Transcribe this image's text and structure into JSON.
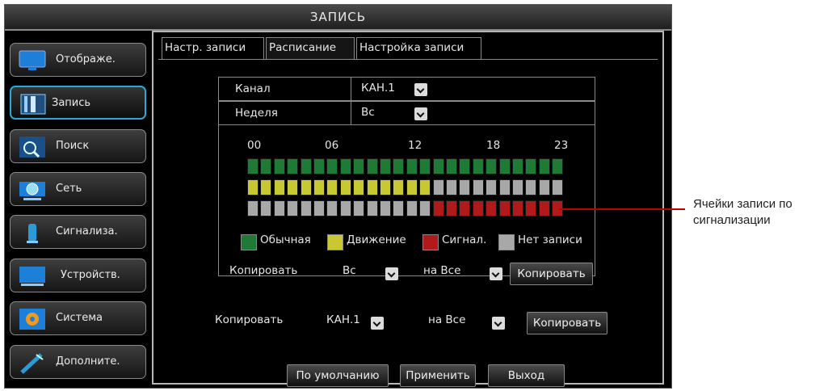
{
  "window": {
    "title": "ЗАПИСЬ"
  },
  "sidebar": {
    "items": [
      {
        "label": "Отображе.",
        "icon": "monitor-icon",
        "active": false
      },
      {
        "label": "Запись",
        "icon": "film-record-icon",
        "active": true
      },
      {
        "label": "Поиск",
        "icon": "search-magnifier-icon",
        "active": false
      },
      {
        "label": "Сеть",
        "icon": "network-globe-icon",
        "active": false
      },
      {
        "label": "Сигнализа.",
        "icon": "alarm-icon",
        "active": false
      },
      {
        "label": "Устройств.",
        "icon": "device-monitor-icon",
        "active": false
      },
      {
        "label": "Система",
        "icon": "gear-icon",
        "active": false
      },
      {
        "label": "Дополните.",
        "icon": "tools-icon",
        "active": false
      }
    ]
  },
  "tabs": [
    {
      "label": "Настр. записи",
      "selected": false
    },
    {
      "label": "Расписание",
      "selected": true
    },
    {
      "label": "Настройка записи",
      "selected": false
    }
  ],
  "schedule": {
    "channel_label": "Канал",
    "channel_value": "КАН.1",
    "week_label": "Неделя",
    "week_value": "Вс",
    "hour_labels": [
      "00",
      "06",
      "12",
      "18",
      "23"
    ],
    "rows": [
      {
        "name": "normal",
        "cells": [
          "N",
          "N",
          "N",
          "N",
          "N",
          "N",
          "N",
          "N",
          "N",
          "N",
          "N",
          "N",
          "N",
          "N",
          "N",
          "N",
          "N",
          "N",
          "N",
          "N",
          "N",
          "N",
          "N",
          "N"
        ]
      },
      {
        "name": "motion",
        "cells": [
          "M",
          "M",
          "M",
          "M",
          "M",
          "M",
          "M",
          "M",
          "M",
          "M",
          "M",
          "M",
          "M",
          "M",
          "X",
          "X",
          "X",
          "X",
          "X",
          "X",
          "X",
          "X",
          "X",
          "X"
        ]
      },
      {
        "name": "alarm",
        "cells": [
          "X",
          "X",
          "X",
          "X",
          "X",
          "X",
          "X",
          "X",
          "X",
          "X",
          "X",
          "X",
          "X",
          "X",
          "A",
          "A",
          "A",
          "A",
          "A",
          "A",
          "A",
          "A",
          "A",
          "A"
        ]
      }
    ],
    "legend": {
      "normal": "Обычная",
      "motion": "Движение",
      "alarm": "Сигнал.",
      "none": "Нет записи"
    },
    "colors": {
      "normal": "#1e7a35",
      "motion": "#c8c832",
      "alarm": "#b01a1a",
      "none": "#a8a8a8"
    },
    "copy_day": {
      "label": "Копировать",
      "from": "Вс",
      "to_label": "на Все",
      "button": "Копировать"
    }
  },
  "copy_channel": {
    "label": "Копировать",
    "from": "КАН.1",
    "to_label": "на Все",
    "button": "Копировать"
  },
  "footer": {
    "default_button": "По умолчанию",
    "apply_button": "Применить",
    "exit_button": "Выход"
  },
  "callout": {
    "text": "Ячейки записи по сигнализации",
    "color": "#c00000"
  }
}
